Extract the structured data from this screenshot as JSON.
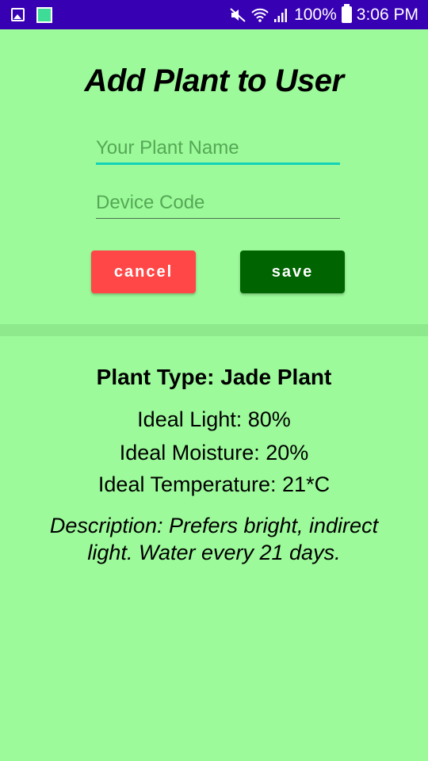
{
  "status_bar": {
    "battery": "100%",
    "time": "3:06 PM",
    "icons": [
      "image-icon",
      "app-icon",
      "mute-icon",
      "wifi-icon",
      "signal-icon",
      "battery-icon"
    ]
  },
  "form": {
    "title": "Add Plant to User",
    "plant_name_placeholder": "Your Plant Name",
    "plant_name_value": "",
    "device_code_placeholder": "Device Code",
    "device_code_value": "",
    "cancel_label": "cancel",
    "save_label": "save"
  },
  "plant_info": {
    "type": "Plant Type: Jade Plant",
    "light": "Ideal Light: 80%",
    "moisture": "Ideal Moisture: 20%",
    "temperature": "Ideal Temperature: 21*C",
    "description": "Description: Prefers bright, indirect light. Water every 21 days."
  },
  "colors": {
    "background": "#9cfa9a",
    "status_bar": "#3700b3",
    "cancel": "#ff4747",
    "save": "#006400",
    "accent": "#12d3b9"
  }
}
